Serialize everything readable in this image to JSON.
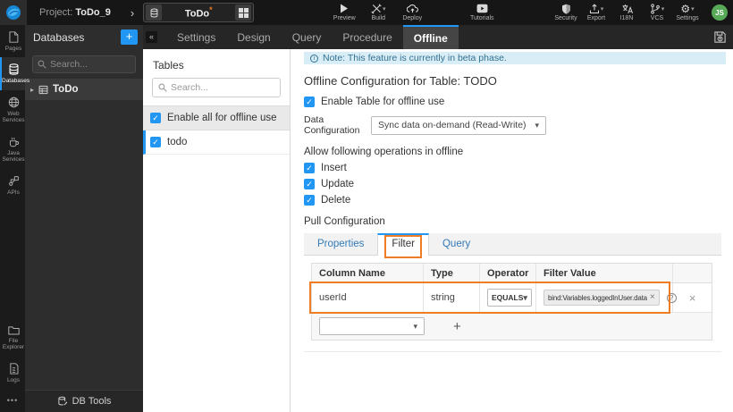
{
  "topbar": {
    "project_prefix": "Project:",
    "project_name": "ToDo_9",
    "app_tab": {
      "name": "ToDo",
      "unsaved_marker": "*"
    },
    "preview": "Preview",
    "build": "Build",
    "deploy": "Deploy",
    "tutorials": "Tutorials",
    "security": "Security",
    "export": "Export",
    "i18n": "I18N",
    "vcs": "VCS",
    "settings": "Settings",
    "avatar_initials": "JS"
  },
  "sidebar": {
    "items": [
      {
        "label": "Pages"
      },
      {
        "label": "Databases"
      },
      {
        "label": "Web Services"
      },
      {
        "label": "Java Services"
      },
      {
        "label": "APIs"
      }
    ],
    "active_item": "Databases",
    "bottom_items": [
      {
        "label": "File Explorer"
      },
      {
        "label": "Logs"
      }
    ]
  },
  "databases_panel": {
    "title": "Databases",
    "search_placeholder": "Search...",
    "items": [
      {
        "label": "ToDo"
      }
    ],
    "footer_label": "DB Tools"
  },
  "editor_tabs": {
    "items": [
      "Settings",
      "Design",
      "Query",
      "Procedure",
      "Offline"
    ],
    "active": "Offline"
  },
  "tables_panel": {
    "title": "Tables",
    "search_placeholder": "Search...",
    "enable_all_label": "Enable all for offline use",
    "tables": [
      {
        "name": "todo",
        "checked": true,
        "selected": true
      }
    ]
  },
  "main": {
    "note_text": "Note: This feature is currently in beta phase.",
    "heading": "Offline Configuration for Table: TODO",
    "enable_table_label": "Enable Table for offline use",
    "data_configuration": {
      "label": "Data Configuration",
      "value": "Sync data on-demand (Read-Write)"
    },
    "operations_label": "Allow following operations in offline",
    "operations": [
      {
        "label": "Insert",
        "checked": true
      },
      {
        "label": "Update",
        "checked": true
      },
      {
        "label": "Delete",
        "checked": true
      }
    ],
    "pull_configuration_label": "Pull Configuration",
    "pull_tabs": {
      "items": [
        "Properties",
        "Filter",
        "Query"
      ],
      "active": "Filter"
    },
    "filter_table": {
      "headers": [
        "Column Name",
        "Type",
        "Operator",
        "Filter Value"
      ],
      "row": {
        "column_name": "userId",
        "type": "string",
        "operator": "EQUALS",
        "filter_value": "bind:Variables.loggedInUser.data"
      }
    }
  },
  "colors": {
    "accent_blue": "#2196f3",
    "annotation_orange": "#ee7d26",
    "note_bg": "#d9edf7",
    "note_text": "#31708f",
    "avatar_green": "#57a957",
    "unsaved_marker_orange": "#ee7d26"
  }
}
